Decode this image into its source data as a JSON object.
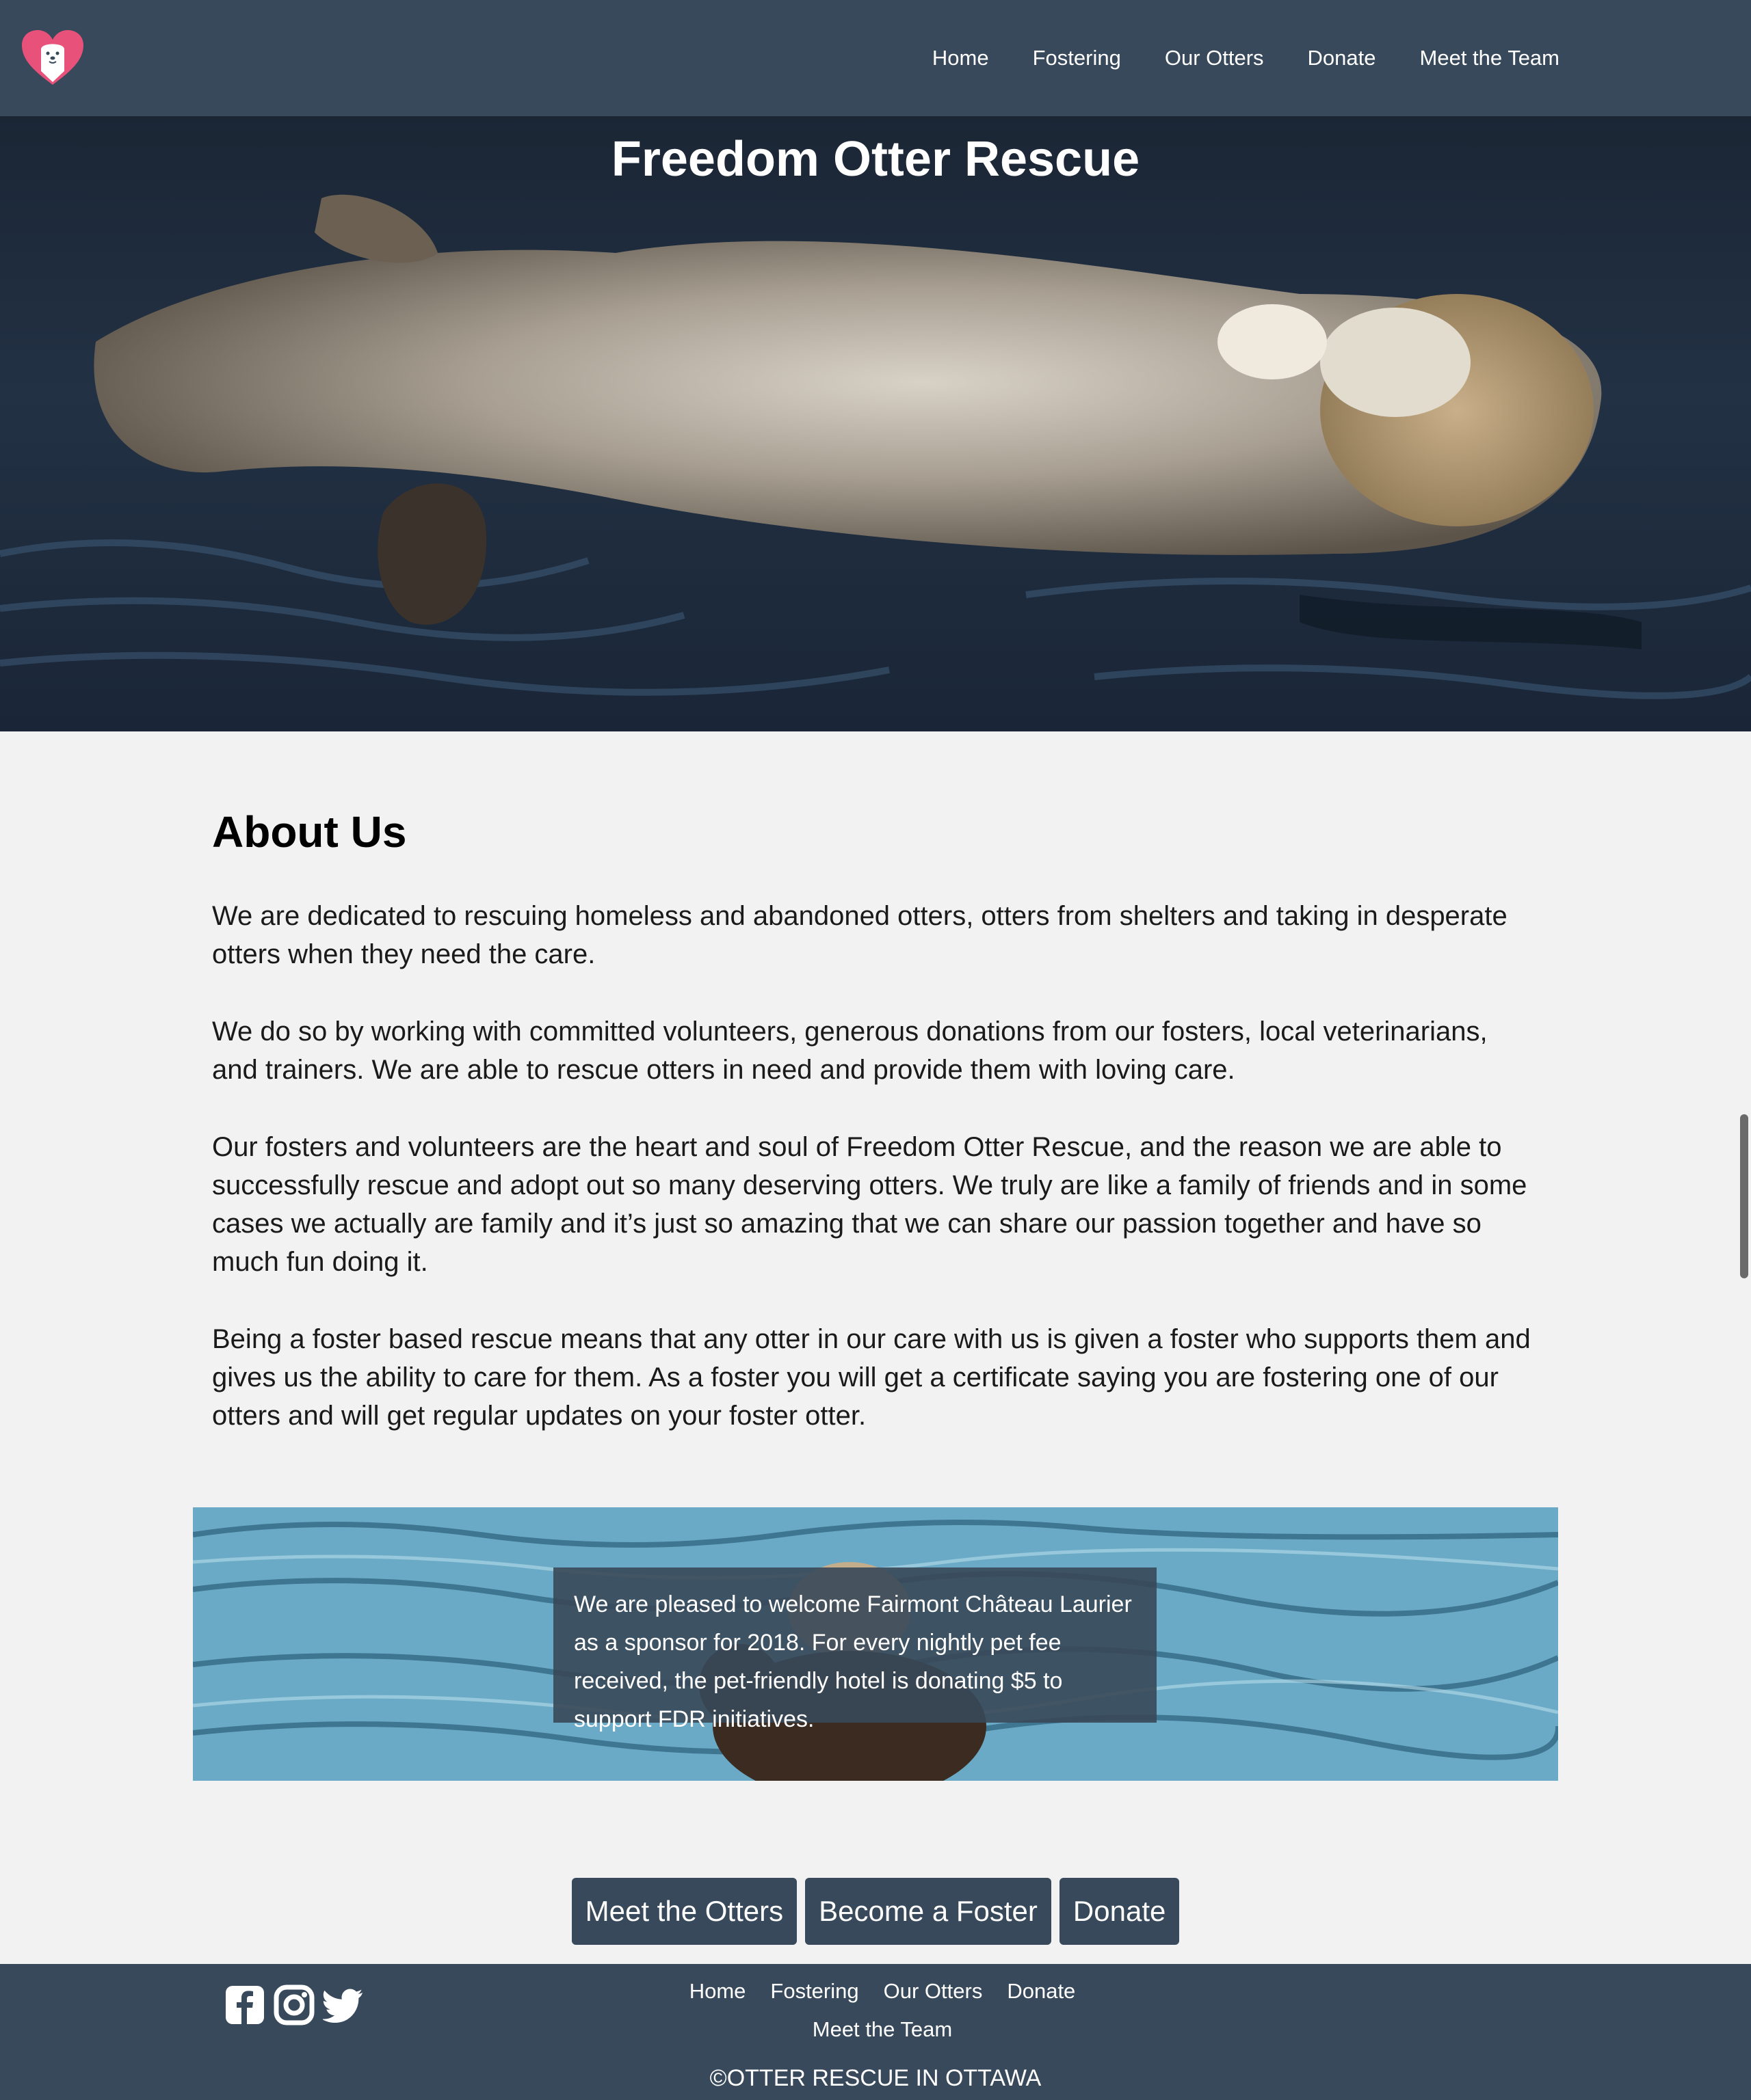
{
  "nav": {
    "links": [
      "Home",
      "Fostering",
      "Our Otters",
      "Donate",
      "Meet the Team"
    ]
  },
  "hero": {
    "title": "Freedom Otter Rescue"
  },
  "about": {
    "heading": "About Us",
    "paragraphs": [
      "We are dedicated to rescuing homeless and abandoned otters, otters from shelters and taking in desperate otters when they need the care.",
      "We do so by working with committed volunteers, generous donations from our fosters, local veterinarians, and trainers. We are able to rescue otters in need and provide them with loving care.",
      "Our fosters and volunteers are the heart and soul of Freedom Otter Rescue, and the reason we are able to successfully rescue and adopt out so many deserving otters. We truly are like a family of friends and in some cases we actually are family and it’s just so amazing that we can share our passion together and have so much fun doing it.",
      "Being a foster based rescue means that any otter in our care with us is given a foster who supports them and gives us the ability to care for them. As a foster you will get a certificate saying you are fostering one of our otters and will get regular updates on your foster otter."
    ]
  },
  "banner": {
    "text": "We are pleased to welcome Fairmont Château Laurier as a sponsor for 2018. For every nightly pet fee received, the pet-friendly hotel is donating $5 to support FDR initiatives."
  },
  "cta": {
    "buttons": [
      "Meet the Otters",
      "Become a Foster",
      "Donate"
    ]
  },
  "footer": {
    "links": [
      "Home",
      "Fostering",
      "Our Otters",
      "Donate",
      "Meet the Team"
    ],
    "copyright": "©OTTER RESCUE IN OTTAWA",
    "social_icons": [
      "facebook-icon",
      "instagram-icon",
      "twitter-icon"
    ]
  },
  "colors": {
    "primary": "#37495a",
    "background": "#f2f2f2",
    "logo_heart": "#e8517a"
  }
}
